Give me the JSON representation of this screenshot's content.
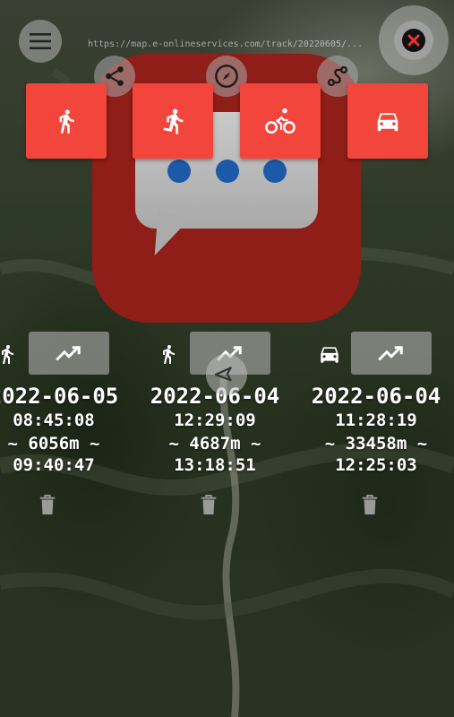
{
  "map": {
    "url_text": "https://map.e-onlineservices.com/track/20220605/..."
  },
  "controls": {
    "menu_icon": "menu-icon",
    "close_icon": "close-icon",
    "share_icon": "share-icon",
    "compass_icon": "compass-icon",
    "route_icon": "route-icon",
    "location_icon": "navigation-arrow-icon"
  },
  "mode_buttons": [
    {
      "icon": "walk-icon"
    },
    {
      "icon": "run-icon"
    },
    {
      "icon": "bike-icon"
    },
    {
      "icon": "car-icon"
    }
  ],
  "tracks": [
    {
      "mode_icon": "walk-icon",
      "date": "2022-06-05",
      "start": "08:45:08",
      "distance": "~ 6056m ~",
      "end": "09:40:47"
    },
    {
      "mode_icon": "walk-icon",
      "date": "2022-06-04",
      "start": "12:29:09",
      "distance": "~ 4687m ~",
      "end": "13:18:51"
    },
    {
      "mode_icon": "car-icon",
      "date": "2022-06-04",
      "start": "11:28:19",
      "distance": "~ 33458m ~",
      "end": "12:25:03"
    }
  ],
  "colors": {
    "accent": "#f2463c",
    "app_icon_bg": "#8f1d18",
    "dots": "#1c5aa8"
  }
}
